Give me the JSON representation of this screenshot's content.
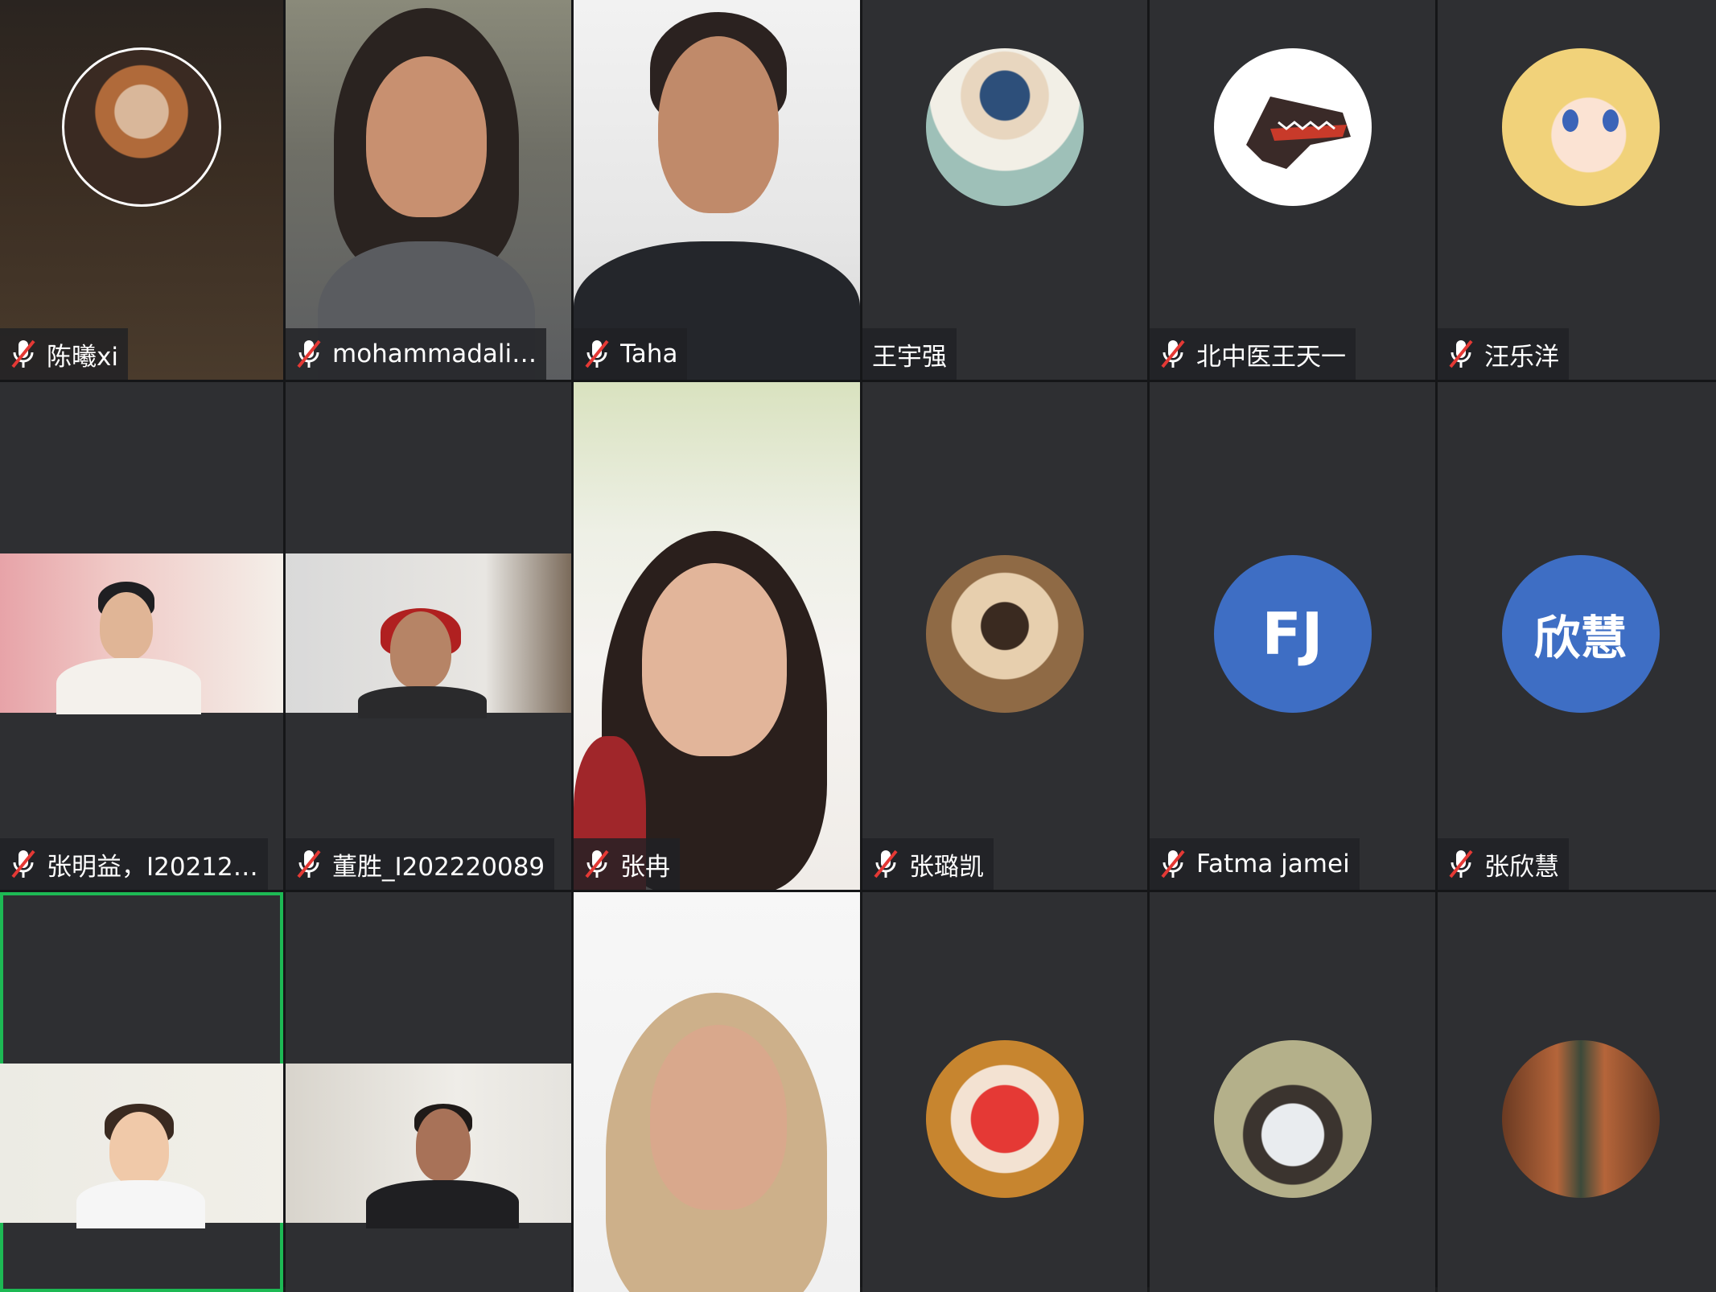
{
  "participants": [
    {
      "name": "陈曦xi",
      "muted": true
    },
    {
      "name": "mohammadali…",
      "muted": true
    },
    {
      "name": "Taha",
      "muted": true
    },
    {
      "name": "王宇强",
      "muted": false
    },
    {
      "name": "北中医王天一",
      "muted": true
    },
    {
      "name": "汪乐洋",
      "muted": true
    },
    {
      "name": "张明益，I20212…",
      "muted": true
    },
    {
      "name": "董胜_I202220089",
      "muted": true
    },
    {
      "name": "张冉",
      "muted": true
    },
    {
      "name": "张璐凯",
      "muted": true
    },
    {
      "name": "Fatma jamei",
      "muted": true,
      "initials": "FJ"
    },
    {
      "name": "张欣慧",
      "muted": true,
      "initials": "欣慧"
    },
    {
      "speaking": true
    },
    {},
    {},
    {},
    {},
    {}
  ],
  "icons": {
    "mic": "mic-off-icon"
  },
  "colors": {
    "tile_bg": "#2e2f32",
    "initials_avatar": "#3e6ec4",
    "speaking_border": "#1db954",
    "muted_slash": "#e53935"
  }
}
